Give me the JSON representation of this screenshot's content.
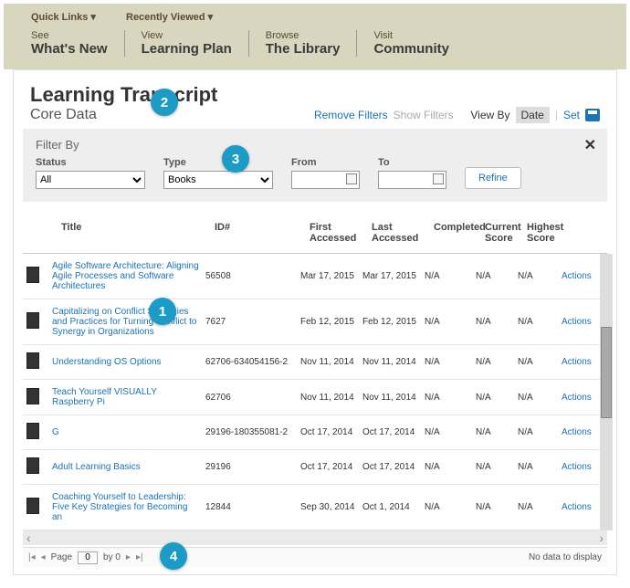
{
  "topnav": {
    "quick_links": "Quick Links ▾",
    "recently_viewed": "Recently Viewed ▾",
    "items": [
      {
        "small": "See",
        "big": "What's New"
      },
      {
        "small": "View",
        "big": "Learning Plan"
      },
      {
        "small": "Browse",
        "big": "The Library"
      },
      {
        "small": "Visit",
        "big": "Community"
      }
    ]
  },
  "panel": {
    "title": "Learning Transcript",
    "subtitle": "Core Data",
    "remove_filters": "Remove Filters",
    "show_filters": "Show Filters",
    "view_by": "View By",
    "date": "Date",
    "set": "Set"
  },
  "filterbar": {
    "title": "Filter By",
    "status_label": "Status",
    "status_value": "All",
    "type_label": "Type",
    "type_value": "Books",
    "from_label": "From",
    "to_label": "To",
    "refine": "Refine",
    "close": "✕"
  },
  "columns": {
    "title": "Title",
    "id": "ID#",
    "first": "First Accessed",
    "last": "Last Accessed",
    "completed": "Completed",
    "current": "Current Score",
    "highest": "Highest Score",
    "actions": "Actions"
  },
  "rows": [
    {
      "title": "Agile Software Architecture: Aligning Agile Processes and Software Architectures",
      "id": "56508",
      "fa": "Mar 17, 2015",
      "la": "Mar 17, 2015",
      "comp": "N/A",
      "cs": "N/A",
      "hs": "N/A",
      "act": "Actions"
    },
    {
      "title": "Capitalizing on Conflict Strategies and Practices for Turning Conflict to Synergy in Organizations",
      "id": "7627",
      "fa": "Feb 12, 2015",
      "la": "Feb 12, 2015",
      "comp": "N/A",
      "cs": "N/A",
      "hs": "N/A",
      "act": "Actions"
    },
    {
      "title": "Understanding OS Options",
      "id": "62706-634054156-2",
      "fa": "Nov 11, 2014",
      "la": "Nov 11, 2014",
      "comp": "N/A",
      "cs": "N/A",
      "hs": "N/A",
      "act": "Actions"
    },
    {
      "title": "Teach Yourself VISUALLY Raspberry Pi",
      "id": "62706",
      "fa": "Nov 11, 2014",
      "la": "Nov 11, 2014",
      "comp": "N/A",
      "cs": "N/A",
      "hs": "N/A",
      "act": "Actions"
    },
    {
      "title": "G",
      "id": "29196-180355081-2",
      "fa": "Oct 17, 2014",
      "la": "Oct 17, 2014",
      "comp": "N/A",
      "cs": "N/A",
      "hs": "N/A",
      "act": "Actions"
    },
    {
      "title": "Adult Learning Basics",
      "id": "29196",
      "fa": "Oct 17, 2014",
      "la": "Oct 17, 2014",
      "comp": "N/A",
      "cs": "N/A",
      "hs": "N/A",
      "act": "Actions"
    },
    {
      "title": "Coaching Yourself to Leadership: Five Key Strategies for Becoming an",
      "id": "12844",
      "fa": "Sep 30, 2014",
      "la": "Oct 1, 2014",
      "comp": "N/A",
      "cs": "N/A",
      "hs": "N/A",
      "act": "Actions"
    }
  ],
  "pager": {
    "page_label": "Page",
    "page_value": "0",
    "by_label": "by 0",
    "no_data": "No data to display"
  },
  "callouts": {
    "c1": "1",
    "c2": "2",
    "c3": "3",
    "c4": "4"
  }
}
